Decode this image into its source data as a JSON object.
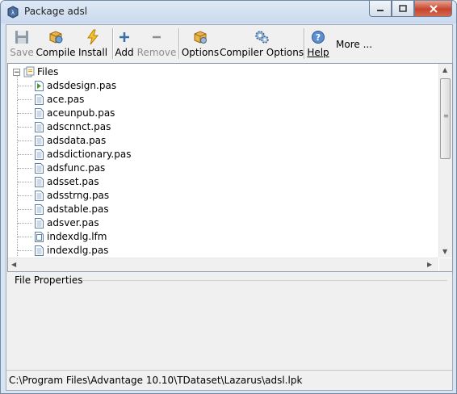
{
  "window": {
    "title": "Package adsl",
    "app_icon": "lazarus-icon",
    "controls": [
      "minimize-icon",
      "maximize-icon",
      "close-icon"
    ]
  },
  "toolbar": {
    "buttons": [
      {
        "label": "Save",
        "icon": "floppy-disk-icon",
        "enabled": false
      },
      {
        "label": "Compile",
        "icon": "compile-icon",
        "enabled": true
      },
      {
        "label": "Install",
        "icon": "lightning-icon",
        "enabled": true
      },
      {
        "label": "Add",
        "icon": "plus-icon",
        "enabled": true
      },
      {
        "label": "Remove",
        "icon": "minus-icon",
        "enabled": false
      },
      {
        "label": "Options",
        "icon": "package-options-icon",
        "enabled": true
      },
      {
        "label": "Compiler Options",
        "icon": "gears-icon",
        "enabled": true
      },
      {
        "label": "Help",
        "icon": "help-icon",
        "enabled": true
      }
    ],
    "more_label": "More ..."
  },
  "tree": {
    "root_label": "Files",
    "items": [
      {
        "name": "adsdesign.pas",
        "icon": "register-unit-icon"
      },
      {
        "name": "ace.pas",
        "icon": "pascal-file-icon"
      },
      {
        "name": "aceunpub.pas",
        "icon": "pascal-file-icon"
      },
      {
        "name": "adscnnct.pas",
        "icon": "pascal-file-icon"
      },
      {
        "name": "adsdata.pas",
        "icon": "pascal-file-icon"
      },
      {
        "name": "adsdictionary.pas",
        "icon": "pascal-file-icon"
      },
      {
        "name": "adsfunc.pas",
        "icon": "pascal-file-icon"
      },
      {
        "name": "adsset.pas",
        "icon": "pascal-file-icon"
      },
      {
        "name": "adsstrng.pas",
        "icon": "pascal-file-icon"
      },
      {
        "name": "adstable.pas",
        "icon": "pascal-file-icon"
      },
      {
        "name": "adsver.pas",
        "icon": "pascal-file-icon"
      },
      {
        "name": "indexdlg.lfm",
        "icon": "form-file-icon"
      },
      {
        "name": "indexdlg.pas",
        "icon": "pascal-file-icon"
      }
    ]
  },
  "properties": {
    "title": "File Properties"
  },
  "status": {
    "path": "C:\\Program Files\\Advantage 10.10\\TDataset\\Lazarus\\adsl.lpk"
  },
  "colors": {
    "accent": "#3a6ea5",
    "close_button": "#c7452d"
  }
}
